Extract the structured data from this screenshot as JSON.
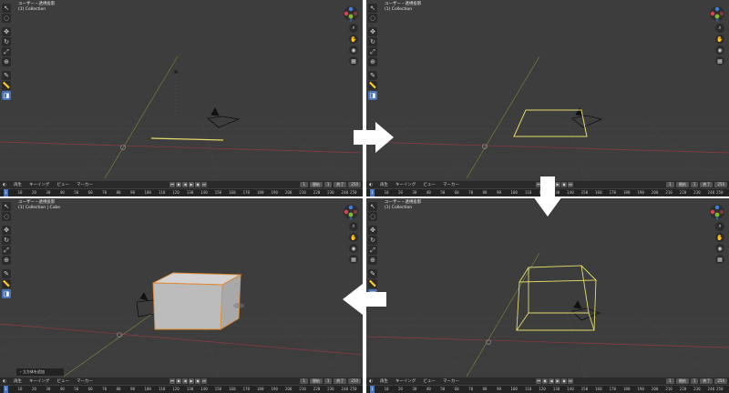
{
  "viewport_header": {
    "line1": "ユーザー・透視投影",
    "line2_collection": "(1) Collection",
    "line2_collection_cube": "(1) Collection | Cube"
  },
  "timeline": {
    "menus": [
      "再生",
      "キーイング",
      "ビュー",
      "マーカー"
    ],
    "current_frame": "1",
    "start_label": "開始",
    "start_value": "1",
    "end_label": "終了",
    "end_value": "250",
    "ruler_ticks": [
      "1",
      "10",
      "20",
      "30",
      "40",
      "50",
      "60",
      "70",
      "80",
      "90",
      "100",
      "110",
      "120",
      "130",
      "140",
      "150",
      "160",
      "170",
      "180",
      "190",
      "200",
      "210",
      "220",
      "230",
      "240",
      "250"
    ]
  },
  "status_tip": "立方体を追加",
  "icons": {
    "tools": [
      "cursor-icon",
      "select-box-icon",
      "move-icon",
      "rotate-icon",
      "scale-icon",
      "transform-icon",
      "annotate-icon",
      "measure-icon",
      "add-cube-icon"
    ],
    "nav": [
      "zoom-icon",
      "hand-icon",
      "camera-view-icon",
      "grid-view-icon"
    ],
    "arrows": [
      "arrow-right-icon",
      "arrow-down-icon",
      "arrow-left-icon"
    ]
  },
  "colors": {
    "viewport_bg": "#3d3d3d",
    "grid": "#4a4a4a",
    "x_axis": "#9b3a44",
    "y_axis": "#8a8a3a",
    "selection_yellow": "#e5dc6a",
    "cube_face": "#c8c8c8",
    "cube_outline": "#e08a35",
    "active_tool": "#4a73b8",
    "gizmo_x": "#e0424f",
    "gizmo_y": "#7dbb2f",
    "gizmo_z": "#3f7fdc"
  }
}
